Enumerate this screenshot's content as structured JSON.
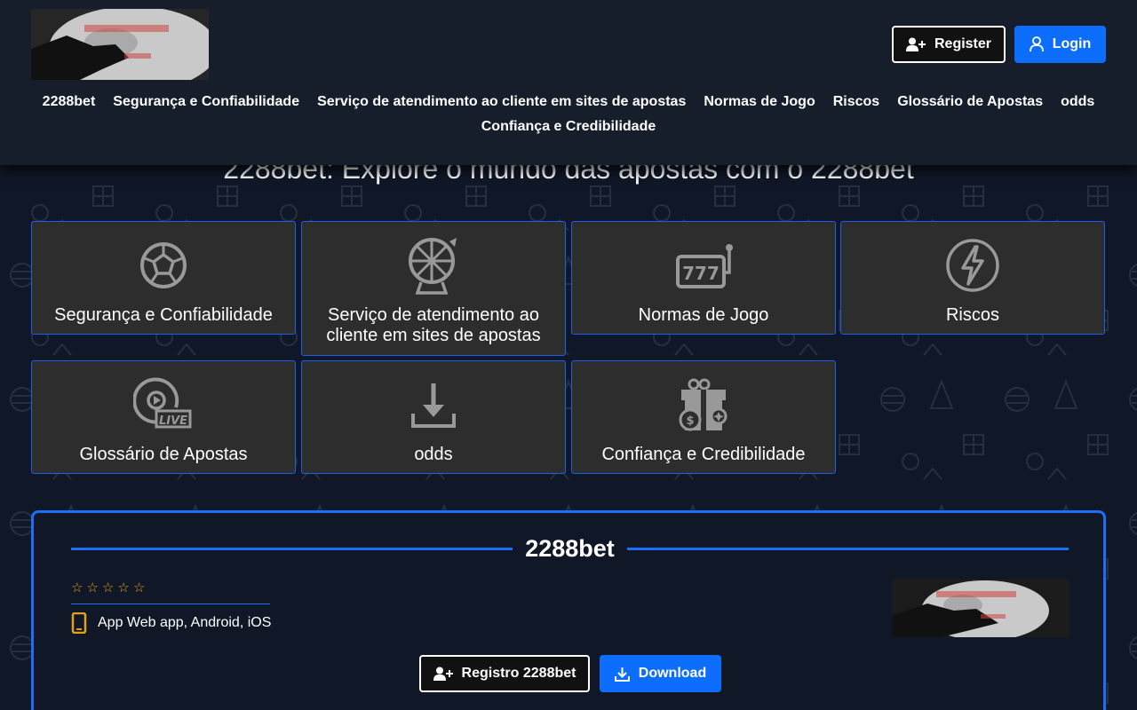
{
  "header": {
    "logo_alt": "2288bet logo",
    "register_label": "Register",
    "login_label": "Login",
    "nav": [
      "2288bet",
      "Segurança e Confiabilidade",
      "Serviço de atendimento ao cliente em sites de apostas",
      "Normas de Jogo",
      "Riscos",
      "Glossário de Apostas",
      "odds",
      "Confiança e Credibilidade"
    ]
  },
  "hero": {
    "title": "2288bet: Explore o mundo das apostas com o 2288bet"
  },
  "cards": [
    {
      "label": "Segurança e Confiabilidade",
      "icon": "soccer-ball-icon"
    },
    {
      "label": "Serviço de atendimento ao cliente em sites de apostas",
      "icon": "roulette-wheel-icon"
    },
    {
      "label": "Normas de Jogo",
      "icon": "slot-machine-icon"
    },
    {
      "label": "Riscos",
      "icon": "lightning-icon"
    },
    {
      "label": "Glossário de Apostas",
      "icon": "live-play-icon"
    },
    {
      "label": "odds",
      "icon": "download-icon"
    },
    {
      "label": "Confiança e Credibilidade",
      "icon": "gift-coins-icon"
    }
  ],
  "panel": {
    "title": "2288bet",
    "rating": 0,
    "rating_max": 5,
    "platform_text": "App Web app, Android, iOS",
    "register_label": "Registro 2288bet",
    "download_label": "Download"
  },
  "colors": {
    "accent": "#0d6efd",
    "card_border": "#1d5ef0",
    "card_bg": "#2d2d2d",
    "page_bg": "#101828",
    "star": "#e0a21b"
  }
}
